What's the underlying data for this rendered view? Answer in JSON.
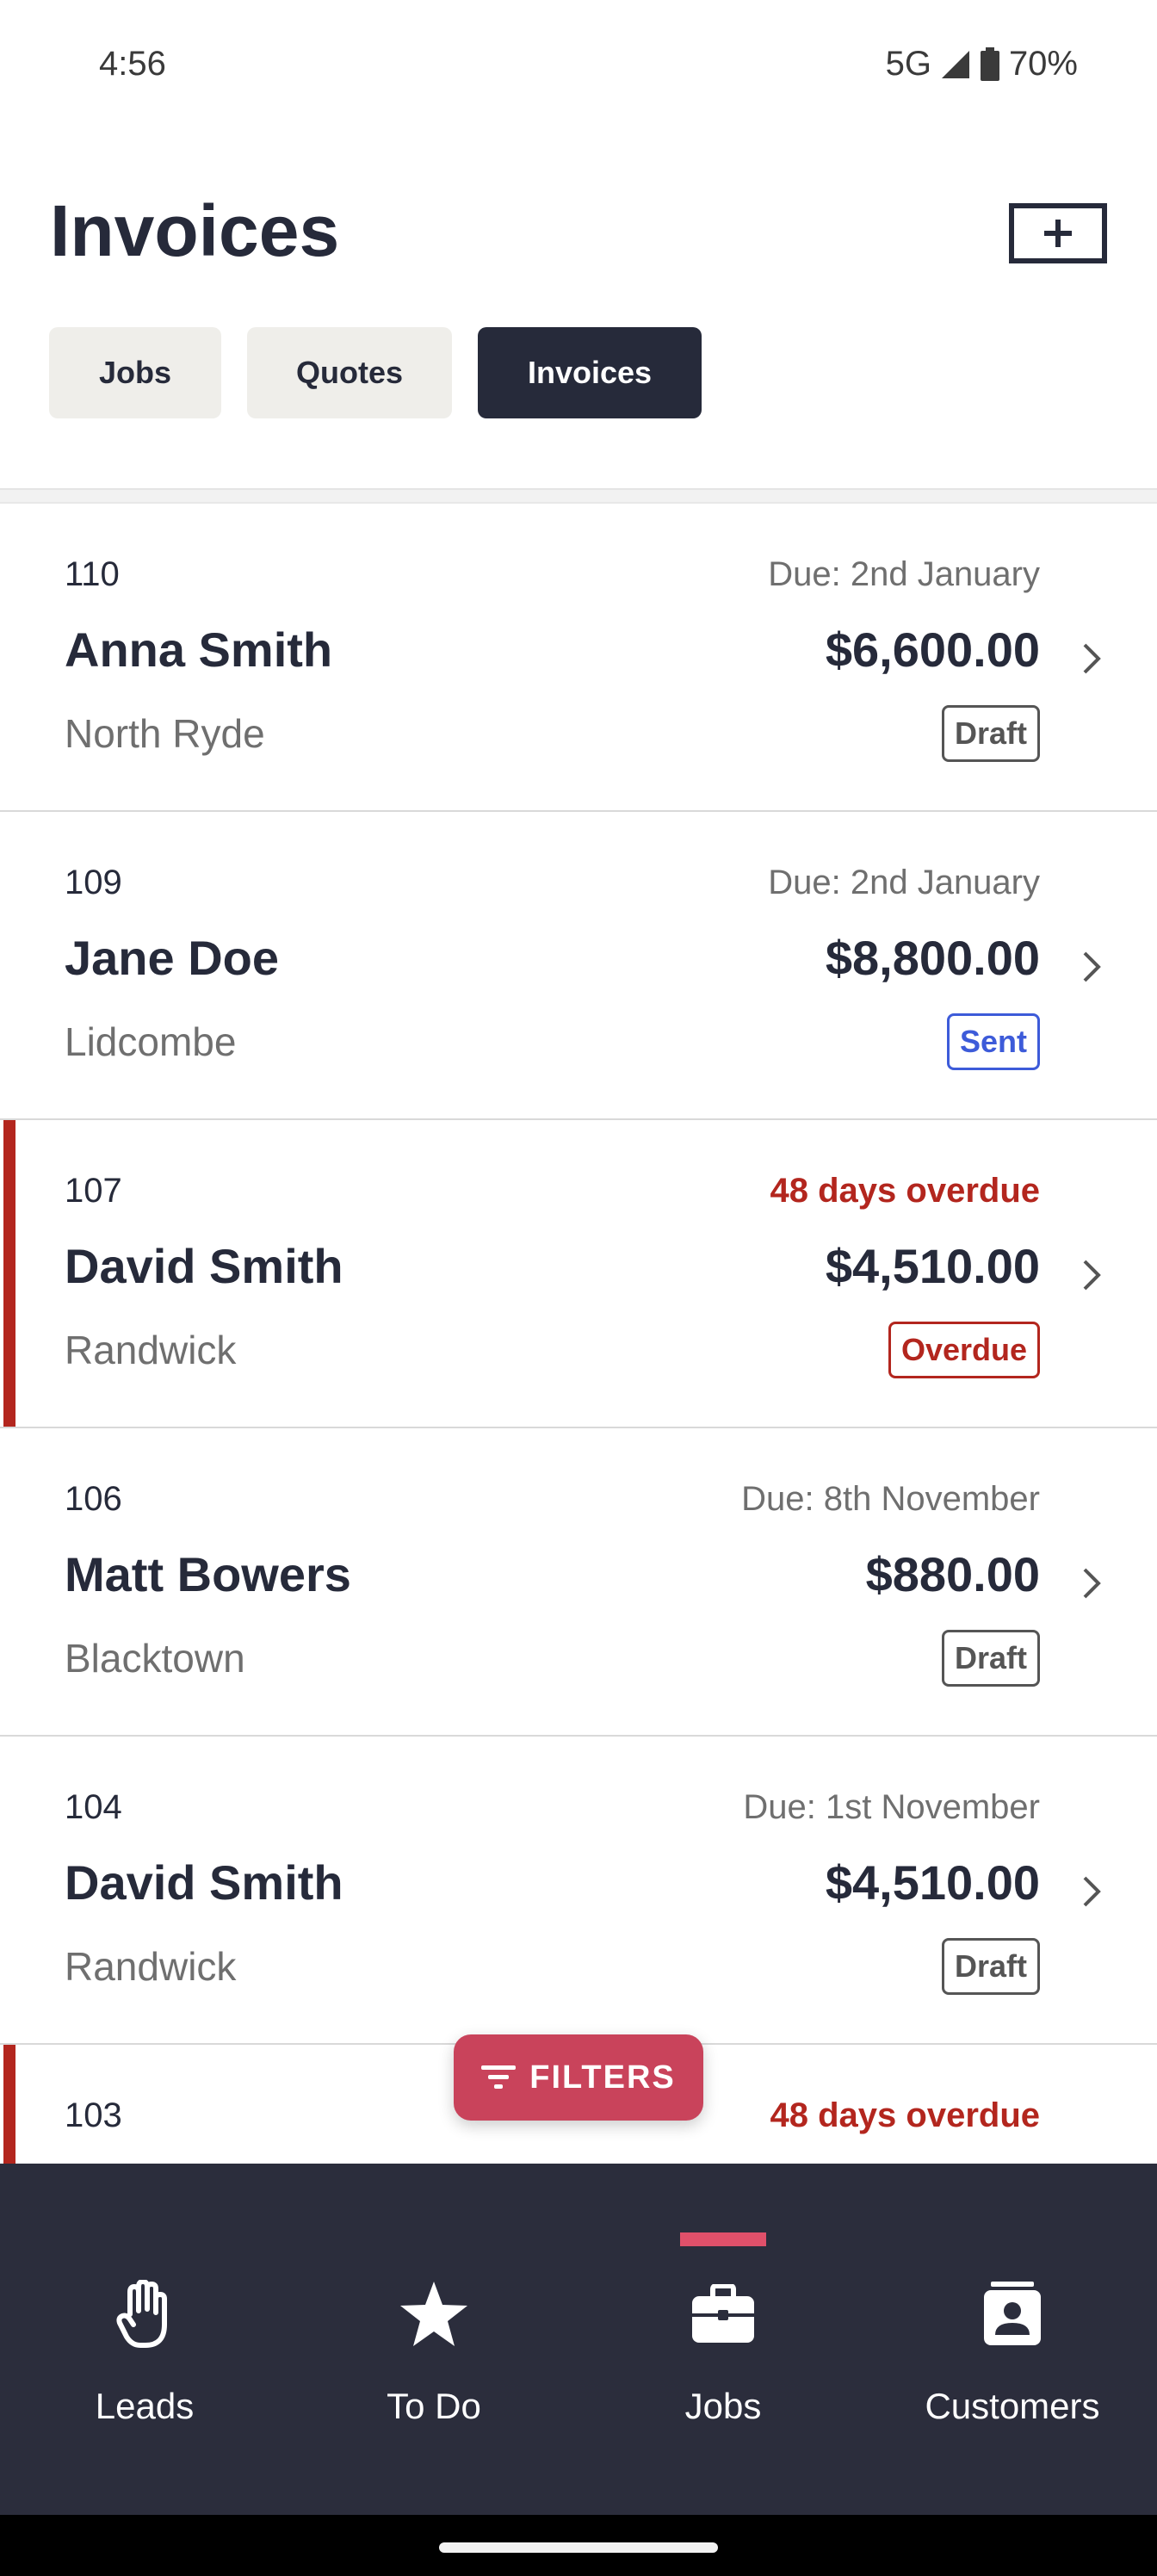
{
  "status_bar": {
    "time": "4:56",
    "network": "5G",
    "battery": "70%"
  },
  "header": {
    "title": "Invoices",
    "add_icon": "plus-icon"
  },
  "tabs": [
    {
      "label": "Jobs",
      "active": false
    },
    {
      "label": "Quotes",
      "active": false
    },
    {
      "label": "Invoices",
      "active": true
    }
  ],
  "invoices": [
    {
      "number": "110",
      "due": "Due: 2nd January",
      "name": "Anna Smith",
      "amount": "$6,600.00",
      "suburb": "North Ryde",
      "status": "Draft",
      "overdue": false
    },
    {
      "number": "109",
      "due": "Due: 2nd January",
      "name": "Jane Doe",
      "amount": "$8,800.00",
      "suburb": "Lidcombe",
      "status": "Sent",
      "overdue": false
    },
    {
      "number": "107",
      "due": "48 days overdue",
      "name": "David Smith",
      "amount": "$4,510.00",
      "suburb": "Randwick",
      "status": "Overdue",
      "overdue": true
    },
    {
      "number": "106",
      "due": "Due: 8th November",
      "name": "Matt Bowers",
      "amount": "$880.00",
      "suburb": "Blacktown",
      "status": "Draft",
      "overdue": false
    },
    {
      "number": "104",
      "due": "Due: 1st November",
      "name": "David Smith",
      "amount": "$4,510.00",
      "suburb": "Randwick",
      "status": "Draft",
      "overdue": false
    },
    {
      "number": "103",
      "due": "48 days overdue",
      "overdue": true
    }
  ],
  "filters": {
    "label": "FILTERS",
    "icon": "filter-icon"
  },
  "bottom_nav": [
    {
      "label": "Leads",
      "icon": "hand-icon",
      "active": false
    },
    {
      "label": "To Do",
      "icon": "star-icon",
      "active": false
    },
    {
      "label": "Jobs",
      "icon": "briefcase-icon",
      "active": true
    },
    {
      "label": "Customers",
      "icon": "contact-card-icon",
      "active": false
    }
  ],
  "colors": {
    "primary_dark": "#262a3a",
    "overdue_red": "#b3261e",
    "sent_blue": "#3d5bd9",
    "accent_pink": "#c9435b",
    "nav_background": "#2b2d3c"
  }
}
